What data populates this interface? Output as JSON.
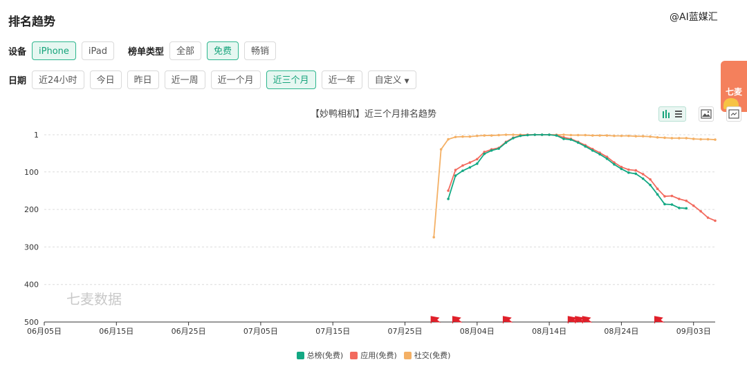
{
  "page": {
    "title": "排名趋势",
    "watermark_top": "@AI蓝媒汇",
    "chart_watermark": "七麦数据"
  },
  "filters": {
    "device_label": "设备",
    "devices": [
      "iPhone",
      "iPad"
    ],
    "device_selected": "iPhone",
    "list_type_label": "榜单类型",
    "list_types": [
      "全部",
      "免费",
      "畅销"
    ],
    "list_type_selected": "免费",
    "date_label": "日期",
    "dates": [
      "近24小时",
      "今日",
      "昨日",
      "近一周",
      "近一个月",
      "近三个月",
      "近一年",
      "自定义"
    ],
    "date_selected": "近三个月"
  },
  "promo": {
    "text_1": "七麦",
    "text_2": "同"
  },
  "colors": {
    "total": "#13a883",
    "app": "#f26a5e",
    "social": "#f4b065",
    "active": "#14a37a",
    "flag": "#e0202a"
  },
  "icons": {
    "toolbox": [
      "bar-chart-icon",
      "list-icon",
      "save-image-icon",
      "restore-icon"
    ],
    "date_custom": "caret-down-icon"
  },
  "chart_data": {
    "type": "line",
    "title": "【妙鸭相机】近三个月排名趋势",
    "y_inverted": true,
    "ylim": [
      1,
      500
    ],
    "y_ticks": [
      1,
      100,
      200,
      300,
      400,
      500
    ],
    "x_range": [
      "2023-06-05",
      "2023-09-06"
    ],
    "x_tick_labels": [
      "06月05日",
      "06月15日",
      "06月25日",
      "07月05日",
      "07月15日",
      "07月25日",
      "08月04日",
      "08月14日",
      "08月24日",
      "09月03日"
    ],
    "x_tick_dates": [
      "2023-06-05",
      "2023-06-15",
      "2023-06-25",
      "2023-07-05",
      "2023-07-15",
      "2023-07-25",
      "2023-08-04",
      "2023-08-14",
      "2023-08-24",
      "2023-09-03"
    ],
    "grid": true,
    "legend_position": "bottom-center",
    "series": [
      {
        "name": "总榜(免费)",
        "color_key": "total",
        "points": [
          [
            "2023-07-31",
            172
          ],
          [
            "2023-08-01",
            110
          ],
          [
            "2023-08-02",
            97
          ],
          [
            "2023-08-03",
            88
          ],
          [
            "2023-08-04",
            78
          ],
          [
            "2023-08-05",
            52
          ],
          [
            "2023-08-06",
            43
          ],
          [
            "2023-08-07",
            38
          ],
          [
            "2023-08-08",
            22
          ],
          [
            "2023-08-09",
            10
          ],
          [
            "2023-08-10",
            4
          ],
          [
            "2023-08-11",
            2
          ],
          [
            "2023-08-12",
            1
          ],
          [
            "2023-08-13",
            1
          ],
          [
            "2023-08-14",
            1
          ],
          [
            "2023-08-15",
            3
          ],
          [
            "2023-08-16",
            12
          ],
          [
            "2023-08-17",
            14
          ],
          [
            "2023-08-18",
            22
          ],
          [
            "2023-08-19",
            32
          ],
          [
            "2023-08-20",
            43
          ],
          [
            "2023-08-21",
            53
          ],
          [
            "2023-08-22",
            65
          ],
          [
            "2023-08-23",
            80
          ],
          [
            "2023-08-24",
            92
          ],
          [
            "2023-08-25",
            102
          ],
          [
            "2023-08-26",
            105
          ],
          [
            "2023-08-27",
            118
          ],
          [
            "2023-08-28",
            135
          ],
          [
            "2023-08-29",
            160
          ],
          [
            "2023-08-30",
            186
          ],
          [
            "2023-08-31",
            187
          ],
          [
            "2023-09-01",
            196
          ],
          [
            "2023-09-02",
            197
          ]
        ]
      },
      {
        "name": "应用(免费)",
        "color_key": "app",
        "points": [
          [
            "2023-07-31",
            150
          ],
          [
            "2023-08-01",
            95
          ],
          [
            "2023-08-02",
            83
          ],
          [
            "2023-08-03",
            75
          ],
          [
            "2023-08-04",
            66
          ],
          [
            "2023-08-05",
            47
          ],
          [
            "2023-08-06",
            40
          ],
          [
            "2023-08-07",
            36
          ],
          [
            "2023-08-08",
            20
          ],
          [
            "2023-08-09",
            9
          ],
          [
            "2023-08-10",
            3
          ],
          [
            "2023-08-11",
            1
          ],
          [
            "2023-08-12",
            1
          ],
          [
            "2023-08-13",
            1
          ],
          [
            "2023-08-14",
            1
          ],
          [
            "2023-08-15",
            2
          ],
          [
            "2023-08-16",
            8
          ],
          [
            "2023-08-17",
            12
          ],
          [
            "2023-08-18",
            20
          ],
          [
            "2023-08-19",
            29
          ],
          [
            "2023-08-20",
            39
          ],
          [
            "2023-08-21",
            49
          ],
          [
            "2023-08-22",
            60
          ],
          [
            "2023-08-23",
            75
          ],
          [
            "2023-08-24",
            87
          ],
          [
            "2023-08-25",
            94
          ],
          [
            "2023-08-26",
            96
          ],
          [
            "2023-08-27",
            106
          ],
          [
            "2023-08-28",
            120
          ],
          [
            "2023-08-29",
            145
          ],
          [
            "2023-08-30",
            165
          ],
          [
            "2023-08-31",
            164
          ],
          [
            "2023-09-01",
            172
          ],
          [
            "2023-09-02",
            177
          ],
          [
            "2023-09-03",
            190
          ],
          [
            "2023-09-04",
            205
          ],
          [
            "2023-09-05",
            222
          ],
          [
            "2023-09-06",
            230
          ]
        ]
      },
      {
        "name": "社交(免费)",
        "color_key": "social",
        "points": [
          [
            "2023-07-29",
            274
          ],
          [
            "2023-07-30",
            40
          ],
          [
            "2023-07-31",
            13
          ],
          [
            "2023-08-01",
            7
          ],
          [
            "2023-08-02",
            6
          ],
          [
            "2023-08-03",
            6
          ],
          [
            "2023-08-04",
            4
          ],
          [
            "2023-08-05",
            3
          ],
          [
            "2023-08-06",
            3
          ],
          [
            "2023-08-07",
            2
          ],
          [
            "2023-08-08",
            1
          ],
          [
            "2023-08-09",
            1
          ],
          [
            "2023-08-10",
            1
          ],
          [
            "2023-08-11",
            1
          ],
          [
            "2023-08-12",
            1
          ],
          [
            "2023-08-13",
            1
          ],
          [
            "2023-08-14",
            1
          ],
          [
            "2023-08-15",
            1
          ],
          [
            "2023-08-16",
            1
          ],
          [
            "2023-08-17",
            2
          ],
          [
            "2023-08-18",
            2
          ],
          [
            "2023-08-19",
            2
          ],
          [
            "2023-08-20",
            3
          ],
          [
            "2023-08-21",
            3
          ],
          [
            "2023-08-22",
            3
          ],
          [
            "2023-08-23",
            4
          ],
          [
            "2023-08-24",
            4
          ],
          [
            "2023-08-25",
            4
          ],
          [
            "2023-08-26",
            5
          ],
          [
            "2023-08-27",
            5
          ],
          [
            "2023-08-28",
            6
          ],
          [
            "2023-08-29",
            8
          ],
          [
            "2023-08-30",
            9
          ],
          [
            "2023-08-31",
            10
          ],
          [
            "2023-09-01",
            10
          ],
          [
            "2023-09-02",
            10
          ],
          [
            "2023-09-03",
            12
          ],
          [
            "2023-09-04",
            13
          ],
          [
            "2023-09-05",
            13
          ],
          [
            "2023-09-06",
            14
          ]
        ]
      }
    ],
    "event_flags": [
      "2023-07-29",
      "2023-08-01",
      "2023-08-08",
      "2023-08-17",
      "2023-08-18",
      "2023-08-19",
      "2023-08-29"
    ]
  }
}
